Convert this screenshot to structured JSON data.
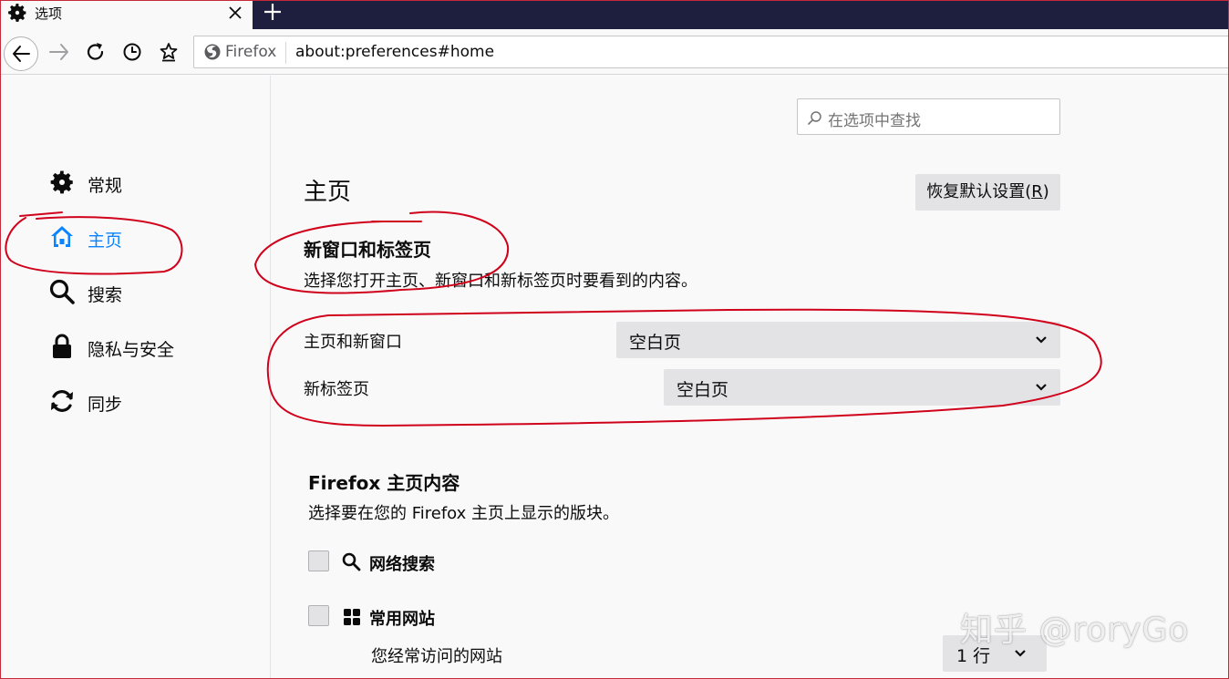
{
  "browser": {
    "tab_title": "选项",
    "url_identity": "Firefox",
    "url": "about:preferences#home"
  },
  "search": {
    "placeholder": "在选项中查找"
  },
  "sidebar": {
    "items": [
      {
        "label": "常规",
        "icon": "gear-icon",
        "selected": false
      },
      {
        "label": "主页",
        "icon": "home-icon",
        "selected": true
      },
      {
        "label": "搜索",
        "icon": "search-icon",
        "selected": false
      },
      {
        "label": "隐私与安全",
        "icon": "lock-icon",
        "selected": false
      },
      {
        "label": "同步",
        "icon": "sync-icon",
        "selected": false
      }
    ]
  },
  "main": {
    "title": "主页",
    "restore_label": "恢复默认设置(",
    "restore_key": "R",
    "restore_tail": ")",
    "new_windows": {
      "heading": "新窗口和标签页",
      "description": "选择您打开主页、新窗口和新标签页时要看到的内容。",
      "homepage_label": "主页和新窗口",
      "homepage_value": "空白页",
      "newtab_label": "新标签页",
      "newtab_value": "空白页"
    },
    "home_content": {
      "heading": "Firefox 主页内容",
      "description": "选择要在您的 Firefox 主页上显示的版块。",
      "web_search_label": "网络搜索",
      "top_sites_label": "常用网站",
      "top_sites_description": "您经常访问的网站",
      "rows_value": "1 行"
    }
  },
  "watermark": "知乎 @roryGo",
  "colors": {
    "accent": "#0a84ff",
    "annotation": "#d0021b",
    "tabstrip": "#1e1e3f"
  }
}
